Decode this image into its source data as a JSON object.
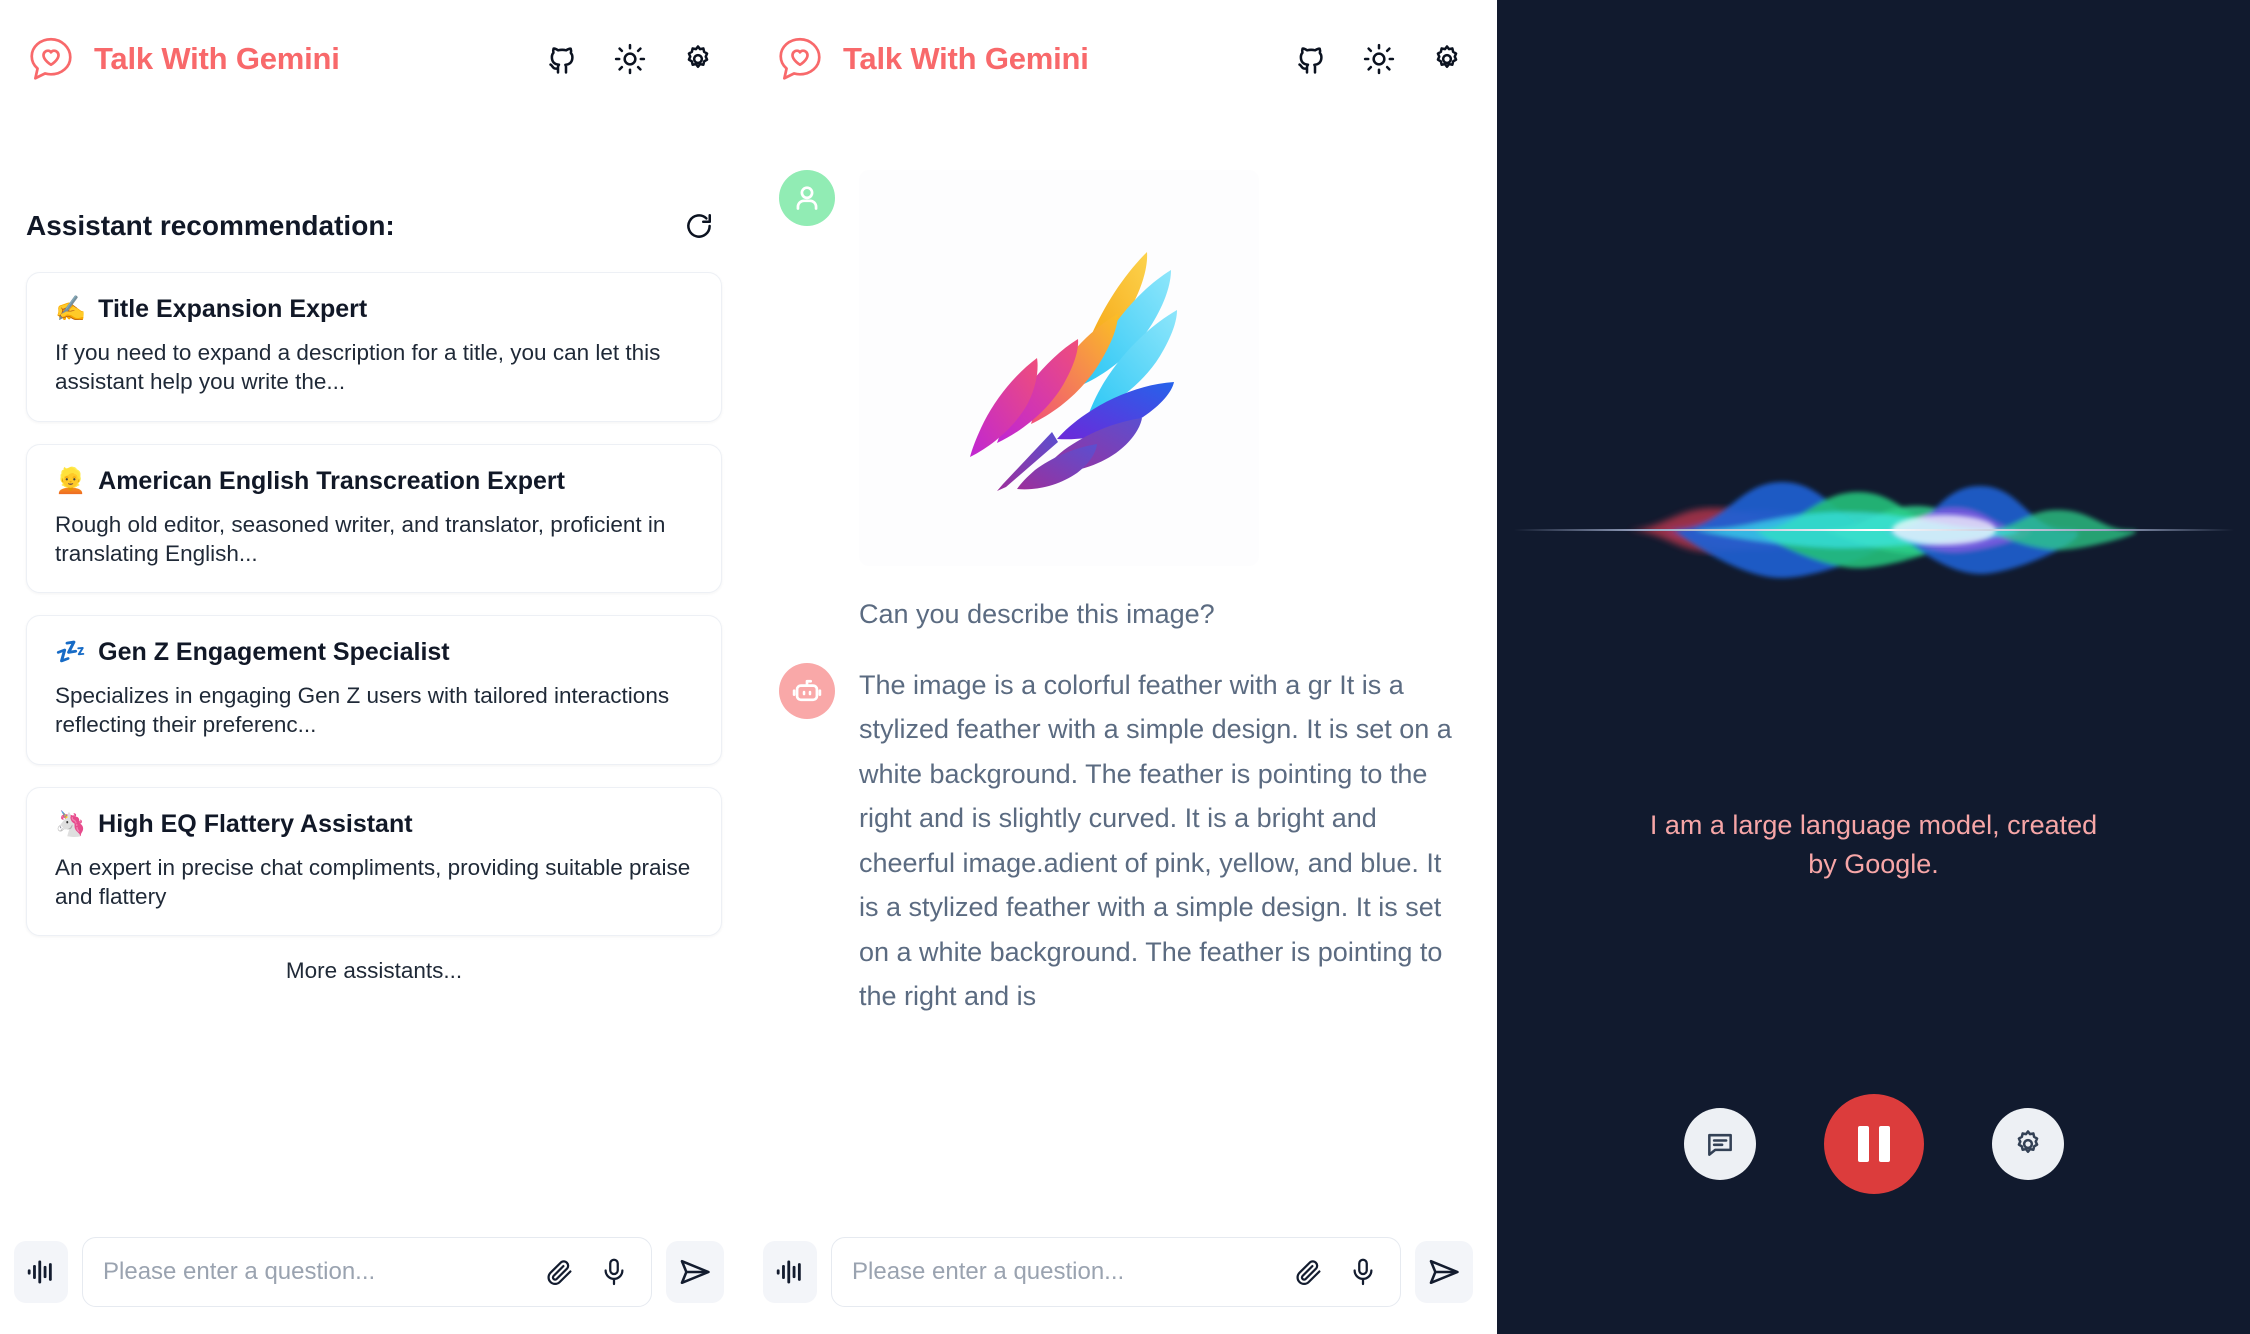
{
  "app": {
    "brand_color": "#f8696b",
    "title": "Talk With Gemini"
  },
  "header": {
    "title": "Talk With Gemini",
    "icons": [
      {
        "name": "github-icon",
        "label": "GitHub"
      },
      {
        "name": "sun-icon",
        "label": "Theme"
      },
      {
        "name": "gear-icon",
        "label": "Settings"
      }
    ]
  },
  "sidebar": {
    "section_title": "Assistant recommendation:",
    "refresh_label": "Refresh",
    "more_label": "More assistants...",
    "cards": [
      {
        "emoji": "✍️",
        "title": "Title Expansion Expert",
        "desc": "If you need to expand a description for a title, you can let this assistant help you write the..."
      },
      {
        "emoji": "👱",
        "title": "American English Transcreation Expert",
        "desc": "Rough old editor, seasoned writer, and translator, proficient in translating English..."
      },
      {
        "emoji": "💤",
        "title": "Gen Z Engagement Specialist",
        "desc": "Specializes in engaging Gen Z users with tailored interactions reflecting their preferenc..."
      },
      {
        "emoji": "🦄",
        "title": "High EQ Flattery Assistant",
        "desc": "An expert in precise chat compliments, providing suitable praise and flattery"
      }
    ]
  },
  "composer": {
    "placeholder": "Please enter a question...",
    "value": "",
    "waveform_label": "Voice mode",
    "attach_label": "Attach file",
    "mic_label": "Microphone",
    "send_label": "Send"
  },
  "chat": {
    "messages": [
      {
        "role": "user",
        "avatar": "user-avatar",
        "has_image": true,
        "image_alt": "colorful feather illustration",
        "text": "Can you describe this image?"
      },
      {
        "role": "assistant",
        "avatar": "bot-avatar",
        "has_image": false,
        "text": "The image is a colorful feather with a gr It is a stylized feather with a simple design. It is set on a white background. The feather is pointing to the right and is slightly curved. It is a bright and cheerful image.adient of pink, yellow, and blue. It is a stylized feather with a simple design. It is set on a white background. The feather is pointing to the right and is"
      }
    ]
  },
  "voice_panel": {
    "background": "#111a2e",
    "caption": "I am a large language model, created by Google.",
    "caption_color": "#f7a6a7",
    "controls": [
      {
        "name": "chat-button",
        "label": "Chat",
        "style": "side"
      },
      {
        "name": "pause-button",
        "label": "Pause",
        "style": "main",
        "color": "#dc3c3c"
      },
      {
        "name": "settings-button",
        "label": "Settings",
        "style": "side"
      }
    ]
  }
}
